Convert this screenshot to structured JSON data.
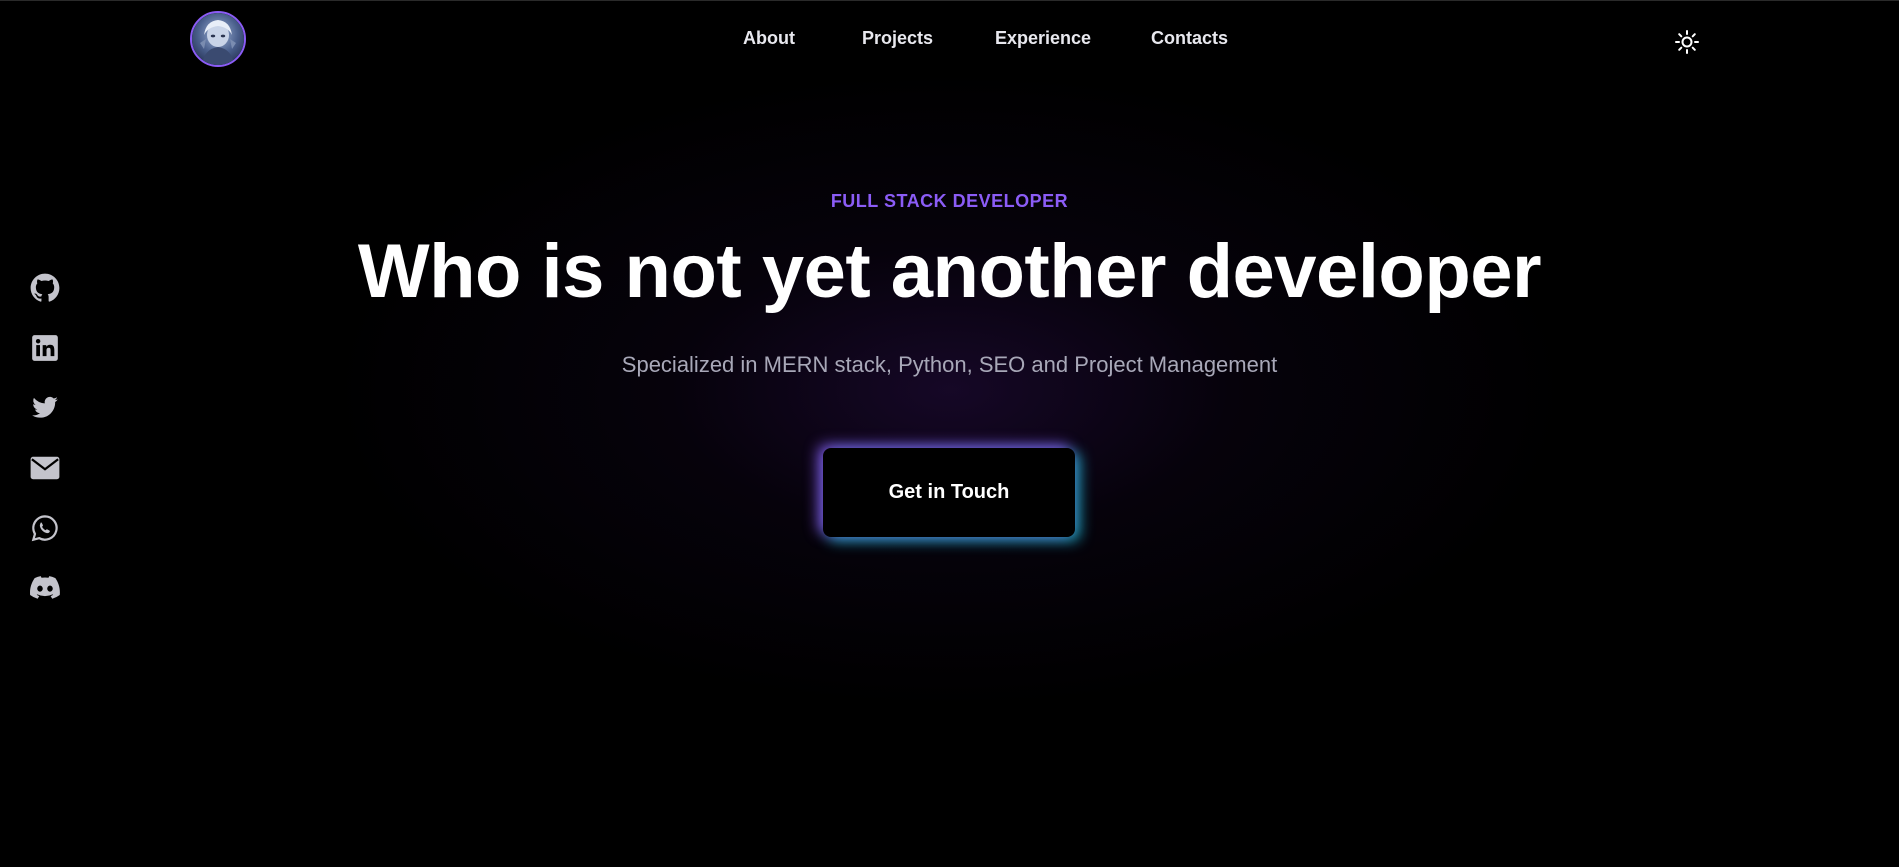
{
  "header": {
    "avatar_icon": "avatar-icon",
    "nav": [
      {
        "label": "About"
      },
      {
        "label": "Projects"
      },
      {
        "label": "Experience"
      },
      {
        "label": "Contacts"
      }
    ],
    "theme_toggle_icon": "sun-icon"
  },
  "socials": [
    {
      "icon": "github-icon"
    },
    {
      "icon": "linkedin-icon"
    },
    {
      "icon": "twitter-icon"
    },
    {
      "icon": "mail-icon"
    },
    {
      "icon": "whatsapp-icon"
    },
    {
      "icon": "discord-icon"
    }
  ],
  "hero": {
    "eyebrow": "FULL STACK DEVELOPER",
    "headline": "Who is not yet another developer",
    "subtitle": "Specialized in MERN stack, Python, SEO and Project Management",
    "cta_label": "Get in Touch"
  },
  "colors": {
    "accent": "#8b5cf6",
    "glow_cyan": "#22d3ee",
    "background": "#000000",
    "text_muted": "#a8a8b8"
  }
}
